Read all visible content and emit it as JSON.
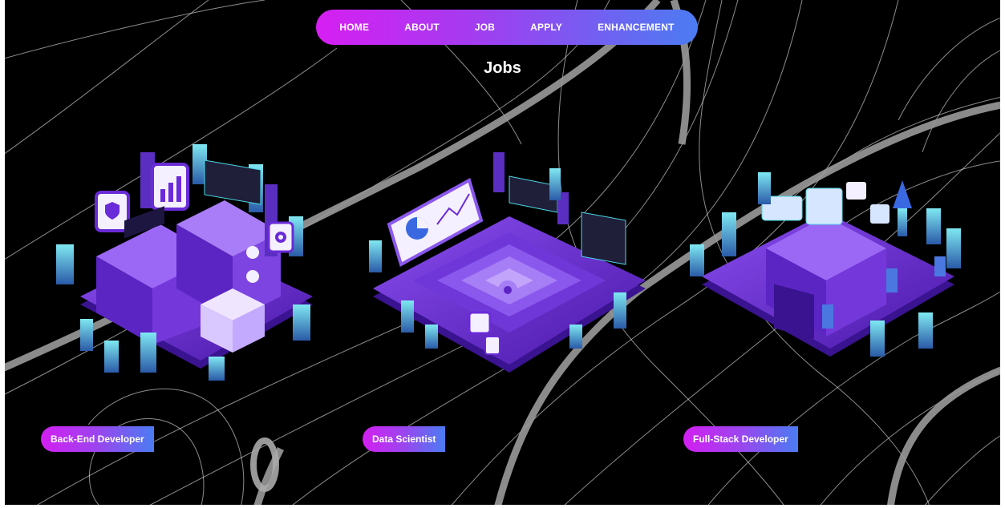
{
  "nav": {
    "items": [
      {
        "label": "HOME"
      },
      {
        "label": "ABOUT"
      },
      {
        "label": "JOB"
      },
      {
        "label": "APPLY"
      },
      {
        "label": "ENHANCEMENT"
      }
    ]
  },
  "page": {
    "title": "Jobs"
  },
  "jobs": [
    {
      "label": "Back-End Developer"
    },
    {
      "label": "Data Scientist"
    },
    {
      "label": "Full-Stack Developer"
    }
  ],
  "colors": {
    "background": "#000000",
    "gradient_start": "#d61ff2",
    "gradient_end": "#4b7cf3",
    "platform_purple": "#6a2bd8",
    "accent_cyan": "#4fd7e6"
  }
}
